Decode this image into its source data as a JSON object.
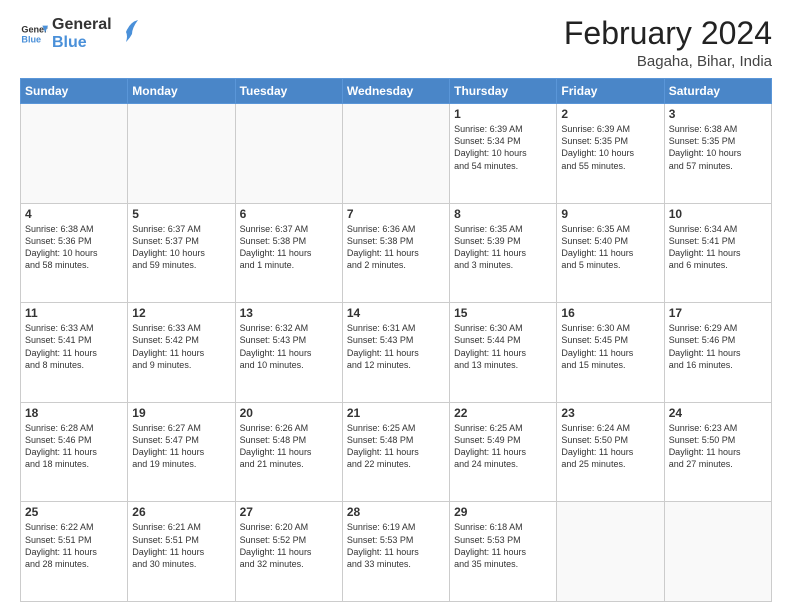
{
  "header": {
    "logo_general": "General",
    "logo_blue": "Blue",
    "month_title": "February 2024",
    "location": "Bagaha, Bihar, India"
  },
  "days_of_week": [
    "Sunday",
    "Monday",
    "Tuesday",
    "Wednesday",
    "Thursday",
    "Friday",
    "Saturday"
  ],
  "weeks": [
    [
      {
        "day": "",
        "info": ""
      },
      {
        "day": "",
        "info": ""
      },
      {
        "day": "",
        "info": ""
      },
      {
        "day": "",
        "info": ""
      },
      {
        "day": "1",
        "info": "Sunrise: 6:39 AM\nSunset: 5:34 PM\nDaylight: 10 hours\nand 54 minutes."
      },
      {
        "day": "2",
        "info": "Sunrise: 6:39 AM\nSunset: 5:35 PM\nDaylight: 10 hours\nand 55 minutes."
      },
      {
        "day": "3",
        "info": "Sunrise: 6:38 AM\nSunset: 5:35 PM\nDaylight: 10 hours\nand 57 minutes."
      }
    ],
    [
      {
        "day": "4",
        "info": "Sunrise: 6:38 AM\nSunset: 5:36 PM\nDaylight: 10 hours\nand 58 minutes."
      },
      {
        "day": "5",
        "info": "Sunrise: 6:37 AM\nSunset: 5:37 PM\nDaylight: 10 hours\nand 59 minutes."
      },
      {
        "day": "6",
        "info": "Sunrise: 6:37 AM\nSunset: 5:38 PM\nDaylight: 11 hours\nand 1 minute."
      },
      {
        "day": "7",
        "info": "Sunrise: 6:36 AM\nSunset: 5:38 PM\nDaylight: 11 hours\nand 2 minutes."
      },
      {
        "day": "8",
        "info": "Sunrise: 6:35 AM\nSunset: 5:39 PM\nDaylight: 11 hours\nand 3 minutes."
      },
      {
        "day": "9",
        "info": "Sunrise: 6:35 AM\nSunset: 5:40 PM\nDaylight: 11 hours\nand 5 minutes."
      },
      {
        "day": "10",
        "info": "Sunrise: 6:34 AM\nSunset: 5:41 PM\nDaylight: 11 hours\nand 6 minutes."
      }
    ],
    [
      {
        "day": "11",
        "info": "Sunrise: 6:33 AM\nSunset: 5:41 PM\nDaylight: 11 hours\nand 8 minutes."
      },
      {
        "day": "12",
        "info": "Sunrise: 6:33 AM\nSunset: 5:42 PM\nDaylight: 11 hours\nand 9 minutes."
      },
      {
        "day": "13",
        "info": "Sunrise: 6:32 AM\nSunset: 5:43 PM\nDaylight: 11 hours\nand 10 minutes."
      },
      {
        "day": "14",
        "info": "Sunrise: 6:31 AM\nSunset: 5:43 PM\nDaylight: 11 hours\nand 12 minutes."
      },
      {
        "day": "15",
        "info": "Sunrise: 6:30 AM\nSunset: 5:44 PM\nDaylight: 11 hours\nand 13 minutes."
      },
      {
        "day": "16",
        "info": "Sunrise: 6:30 AM\nSunset: 5:45 PM\nDaylight: 11 hours\nand 15 minutes."
      },
      {
        "day": "17",
        "info": "Sunrise: 6:29 AM\nSunset: 5:46 PM\nDaylight: 11 hours\nand 16 minutes."
      }
    ],
    [
      {
        "day": "18",
        "info": "Sunrise: 6:28 AM\nSunset: 5:46 PM\nDaylight: 11 hours\nand 18 minutes."
      },
      {
        "day": "19",
        "info": "Sunrise: 6:27 AM\nSunset: 5:47 PM\nDaylight: 11 hours\nand 19 minutes."
      },
      {
        "day": "20",
        "info": "Sunrise: 6:26 AM\nSunset: 5:48 PM\nDaylight: 11 hours\nand 21 minutes."
      },
      {
        "day": "21",
        "info": "Sunrise: 6:25 AM\nSunset: 5:48 PM\nDaylight: 11 hours\nand 22 minutes."
      },
      {
        "day": "22",
        "info": "Sunrise: 6:25 AM\nSunset: 5:49 PM\nDaylight: 11 hours\nand 24 minutes."
      },
      {
        "day": "23",
        "info": "Sunrise: 6:24 AM\nSunset: 5:50 PM\nDaylight: 11 hours\nand 25 minutes."
      },
      {
        "day": "24",
        "info": "Sunrise: 6:23 AM\nSunset: 5:50 PM\nDaylight: 11 hours\nand 27 minutes."
      }
    ],
    [
      {
        "day": "25",
        "info": "Sunrise: 6:22 AM\nSunset: 5:51 PM\nDaylight: 11 hours\nand 28 minutes."
      },
      {
        "day": "26",
        "info": "Sunrise: 6:21 AM\nSunset: 5:51 PM\nDaylight: 11 hours\nand 30 minutes."
      },
      {
        "day": "27",
        "info": "Sunrise: 6:20 AM\nSunset: 5:52 PM\nDaylight: 11 hours\nand 32 minutes."
      },
      {
        "day": "28",
        "info": "Sunrise: 6:19 AM\nSunset: 5:53 PM\nDaylight: 11 hours\nand 33 minutes."
      },
      {
        "day": "29",
        "info": "Sunrise: 6:18 AM\nSunset: 5:53 PM\nDaylight: 11 hours\nand 35 minutes."
      },
      {
        "day": "",
        "info": ""
      },
      {
        "day": "",
        "info": ""
      }
    ]
  ]
}
